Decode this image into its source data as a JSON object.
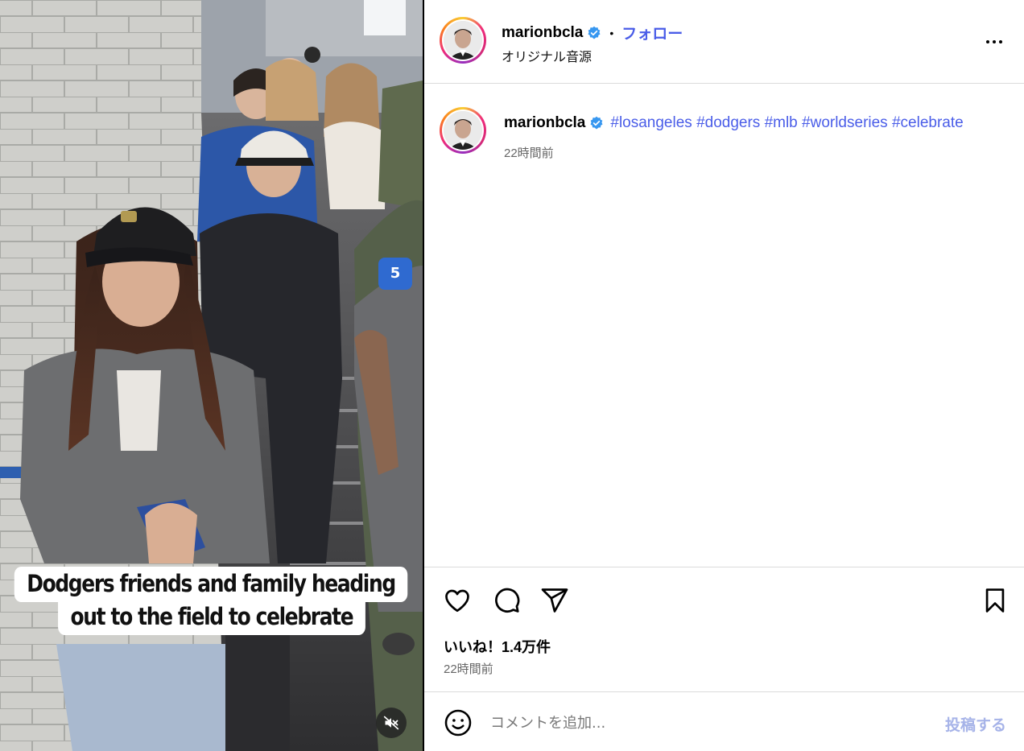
{
  "media": {
    "caption_line1": "Dodgers friends and family heading",
    "caption_line2": "out to the field to celebrate",
    "mute_icon": "speaker-muted-icon"
  },
  "header": {
    "username": "marionbcla",
    "separator": "•",
    "follow_label": "フォロー",
    "audio_label": "オリジナル音源",
    "more_icon": "more-options-icon"
  },
  "post": {
    "username": "marionbcla",
    "hashtags": "#losangeles #dodgers #mlb #worldseries #celebrate",
    "time": "22時間前"
  },
  "actions": {
    "like_icon": "heart-icon",
    "comment_icon": "comment-icon",
    "share_icon": "share-icon",
    "save_icon": "bookmark-icon",
    "likes_text": "いいね！1.4万件",
    "time": "22時間前"
  },
  "comment": {
    "emoji_icon": "emoji-icon",
    "placeholder": "コメントを追加...",
    "post_label": "投稿する"
  },
  "colors": {
    "link_blue": "#4a5de8",
    "verified_blue": "#3797f0",
    "post_button_disabled": "#a6b3e8",
    "divider": "#dbdbdb"
  }
}
